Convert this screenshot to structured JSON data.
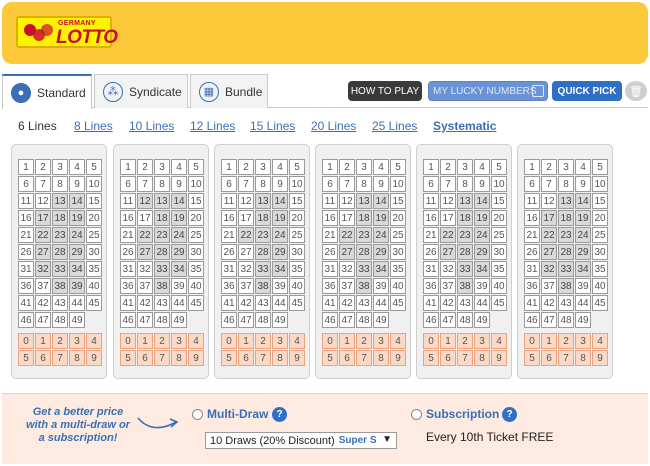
{
  "brand": {
    "top": "GERMANY",
    "main": "LOTTO"
  },
  "tabs": [
    {
      "label": "Standard",
      "icon": "person-icon",
      "active": true
    },
    {
      "label": "Syndicate",
      "icon": "group-icon",
      "active": false
    },
    {
      "label": "Bundle",
      "icon": "gift-icon",
      "active": false
    }
  ],
  "actions": {
    "how_to_play": "HOW TO PLAY",
    "lucky_numbers": "MY LUCKY NUMBERS",
    "quick_pick": "QUICK PICK"
  },
  "line_options": [
    "6 Lines",
    "8 Lines",
    "10 Lines",
    "12 Lines",
    "15 Lines",
    "20 Lines",
    "25 Lines",
    "Systematic"
  ],
  "selected_lines": "6 Lines",
  "numbers": [
    "1",
    "2",
    "3",
    "4",
    "5",
    "6",
    "7",
    "8",
    "9",
    "10",
    "11",
    "12",
    "13",
    "14",
    "15",
    "16",
    "17",
    "18",
    "19",
    "20",
    "21",
    "22",
    "23",
    "24",
    "25",
    "26",
    "27",
    "28",
    "29",
    "30",
    "31",
    "32",
    "33",
    "34",
    "35",
    "36",
    "37",
    "38",
    "39",
    "40",
    "41",
    "42",
    "43",
    "44",
    "45",
    "46",
    "47",
    "48",
    "49"
  ],
  "digits": [
    "0",
    "1",
    "2",
    "3",
    "4",
    "5",
    "6",
    "7",
    "8",
    "9"
  ],
  "ticket_count": 6,
  "promo": {
    "text": "Get a better price with a multi-draw or a subscription!",
    "multi_draw_label": "Multi-Draw",
    "multi_draw_value": "10 Draws (20% Discount)",
    "multi_draw_extra": "Super S",
    "subscription_label": "Subscription",
    "subscription_text": "Every 10th Ticket FREE",
    "help_glyph": "?"
  },
  "colors": {
    "header": "#fcc93a",
    "accent": "#3b6fb5",
    "digit_fill": "#fbd9c6",
    "promo_bg": "#fdeae0"
  }
}
